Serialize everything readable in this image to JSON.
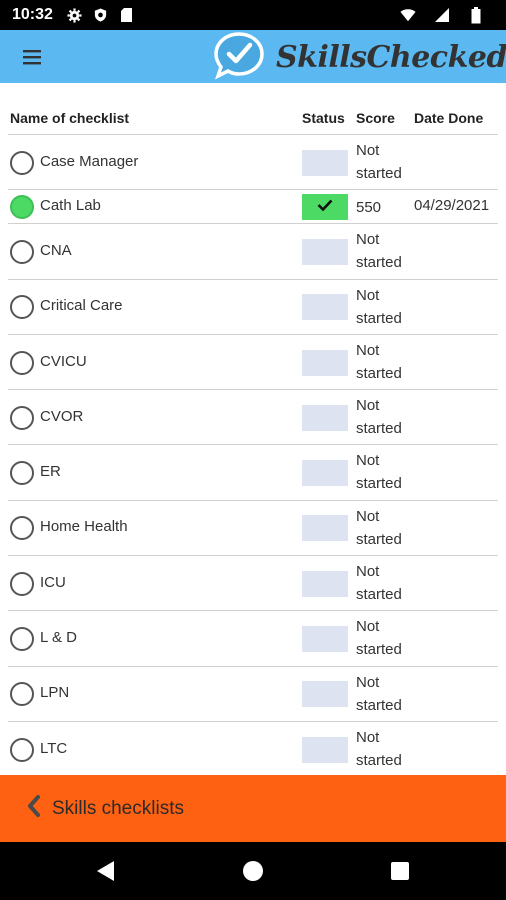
{
  "status_bar": {
    "time": "10:32",
    "icons": [
      "gear-icon",
      "shield-icon",
      "sd-card-icon"
    ],
    "right_icons": [
      "wifi-icon",
      "signal-icon",
      "battery-icon"
    ]
  },
  "app_bar": {
    "menu_icon": "hamburger-menu-icon",
    "logo_icon": "checkmark-bubble-icon",
    "title": "SkillsChecked",
    "brand_color": "#5bb8f0"
  },
  "table": {
    "headers": {
      "name": "Name of checklist",
      "status": "Status",
      "score": "Score",
      "date": "Date Done"
    },
    "rows": [
      {
        "name": "Case Manager",
        "done": false,
        "score": "Not started",
        "date": ""
      },
      {
        "name": "Cath Lab",
        "done": true,
        "score": "550",
        "date": "04/29/2021"
      },
      {
        "name": "CNA",
        "done": false,
        "score": "Not started",
        "date": ""
      },
      {
        "name": "Critical Care",
        "done": false,
        "score": "Not started",
        "date": ""
      },
      {
        "name": "CVICU",
        "done": false,
        "score": "Not started",
        "date": ""
      },
      {
        "name": "CVOR",
        "done": false,
        "score": "Not started",
        "date": ""
      },
      {
        "name": "ER",
        "done": false,
        "score": "Not started",
        "date": ""
      },
      {
        "name": "Home Health",
        "done": false,
        "score": "Not started",
        "date": ""
      },
      {
        "name": "ICU",
        "done": false,
        "score": "Not started",
        "date": ""
      },
      {
        "name": "L & D",
        "done": false,
        "score": "Not started",
        "date": ""
      },
      {
        "name": "LPN",
        "done": false,
        "score": "Not started",
        "date": ""
      },
      {
        "name": "LTC",
        "done": false,
        "score": "Not started",
        "date": ""
      }
    ]
  },
  "footer": {
    "back_icon": "chevron-left-icon",
    "label": "Skills checklists",
    "color": "#ff6112"
  },
  "nav_bar": {
    "buttons": [
      "back-triangle-icon",
      "home-circle-icon",
      "recents-square-icon"
    ]
  }
}
